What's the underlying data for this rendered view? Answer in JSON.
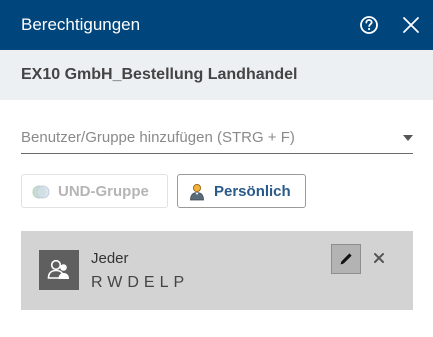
{
  "dialog": {
    "title": "Berechtigungen",
    "help_icon": "help-circle-icon",
    "close_icon": "close-icon"
  },
  "document": {
    "name": "EX10 GmbH_Bestellung Landhandel"
  },
  "add_field": {
    "placeholder": "Benutzer/Gruppe hinzufügen (STRG + F)"
  },
  "buttons": {
    "und_group": {
      "label": "UND-Gruppe",
      "icon": "group-circles-icon",
      "enabled": false
    },
    "personal": {
      "label": "Persönlich",
      "icon": "person-icon",
      "enabled": true
    }
  },
  "entries": [
    {
      "name": "Jeder",
      "permissions": "RWDELP",
      "icon": "users-group-icon"
    }
  ],
  "colors": {
    "titlebar": "#00457c",
    "subheader": "#edf0f3",
    "entry_bg": "#d3d3d3",
    "personal_text": "#2a5a8a"
  }
}
